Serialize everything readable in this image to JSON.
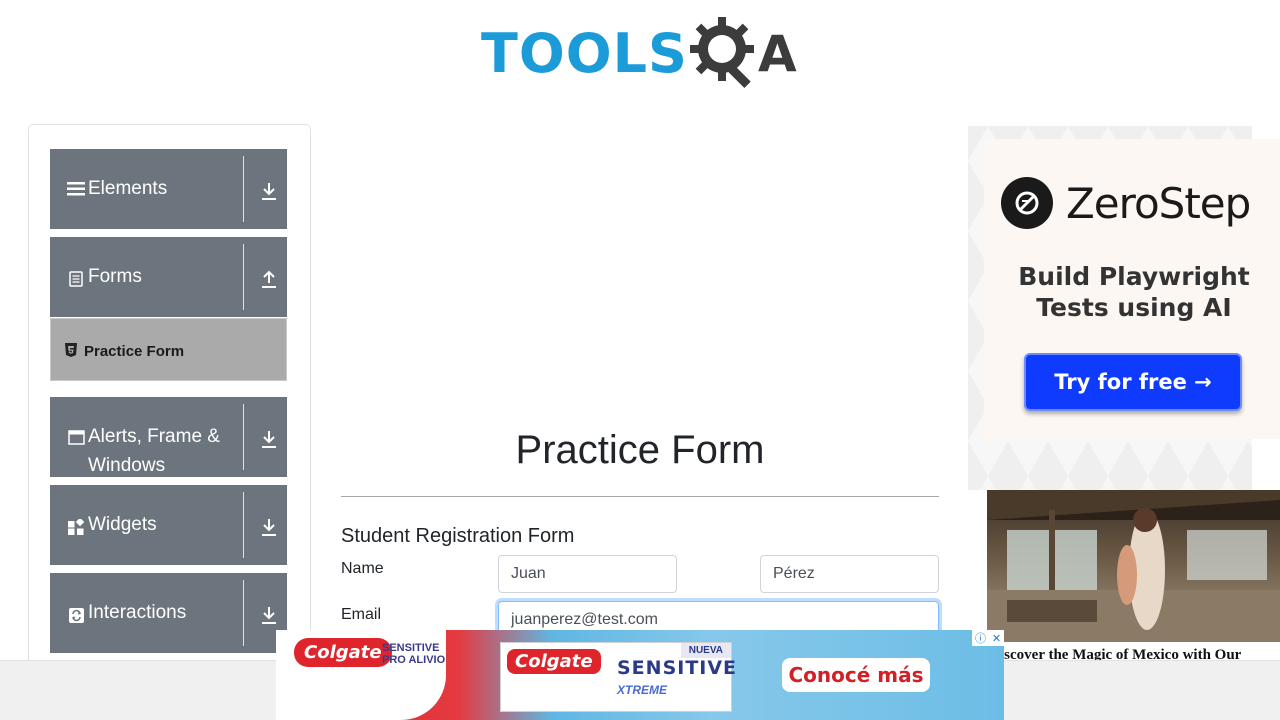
{
  "header": {
    "logo_text": "TOOLS",
    "logo_suffix": "A"
  },
  "sidebar": {
    "groups": [
      {
        "label": "Elements",
        "icon": "list-icon",
        "arrow": "download-arrow-icon"
      },
      {
        "label": "Forms",
        "icon": "document-icon",
        "arrow": "upload-arrow-icon"
      },
      {
        "label": "Alerts, Frame &",
        "label2": "Windows",
        "icon": "window-icon",
        "arrow": "download-arrow-icon"
      },
      {
        "label": "Widgets",
        "icon": "widgets-icon",
        "arrow": "download-arrow-icon"
      },
      {
        "label": "Interactions",
        "icon": "sync-icon",
        "arrow": "download-arrow-icon"
      }
    ],
    "active_item": {
      "label": "Practice Form",
      "icon": "html5-icon"
    }
  },
  "main": {
    "title": "Practice Form",
    "form_heading": "Student Registration Form",
    "fields": {
      "name_label": "Name",
      "first_name_value": "Juan",
      "last_name_value": "Pérez",
      "email_label": "Email",
      "email_value": "juanperez@test.com"
    }
  },
  "ads": {
    "zerostep": {
      "brand": "ZeroStep",
      "tagline_line1": "Build Playwright",
      "tagline_line2": "Tests using AI",
      "cta": "Try for free →",
      "cta_color": "#0f3bff"
    },
    "mexico": {
      "caption": "iscover the Magic of Mexico with Our"
    },
    "colgate": {
      "brand": "Colgate",
      "sensitive": "SENSITIVE",
      "pro_alivio": "PRO ALIVIO",
      "new_badge": "NUEVA",
      "xtreme": "XTREME",
      "cta": "Conocé más",
      "brand_color": "#e0242b"
    },
    "adchoices": {
      "info": "ⓘ",
      "close": "✕"
    }
  },
  "colors": {
    "sidebar_group_bg": "#6c757d",
    "sidebar_active_bg": "#aaaaaa",
    "logo_blue": "#1b9bd8",
    "logo_dark": "#3c3c3c"
  }
}
